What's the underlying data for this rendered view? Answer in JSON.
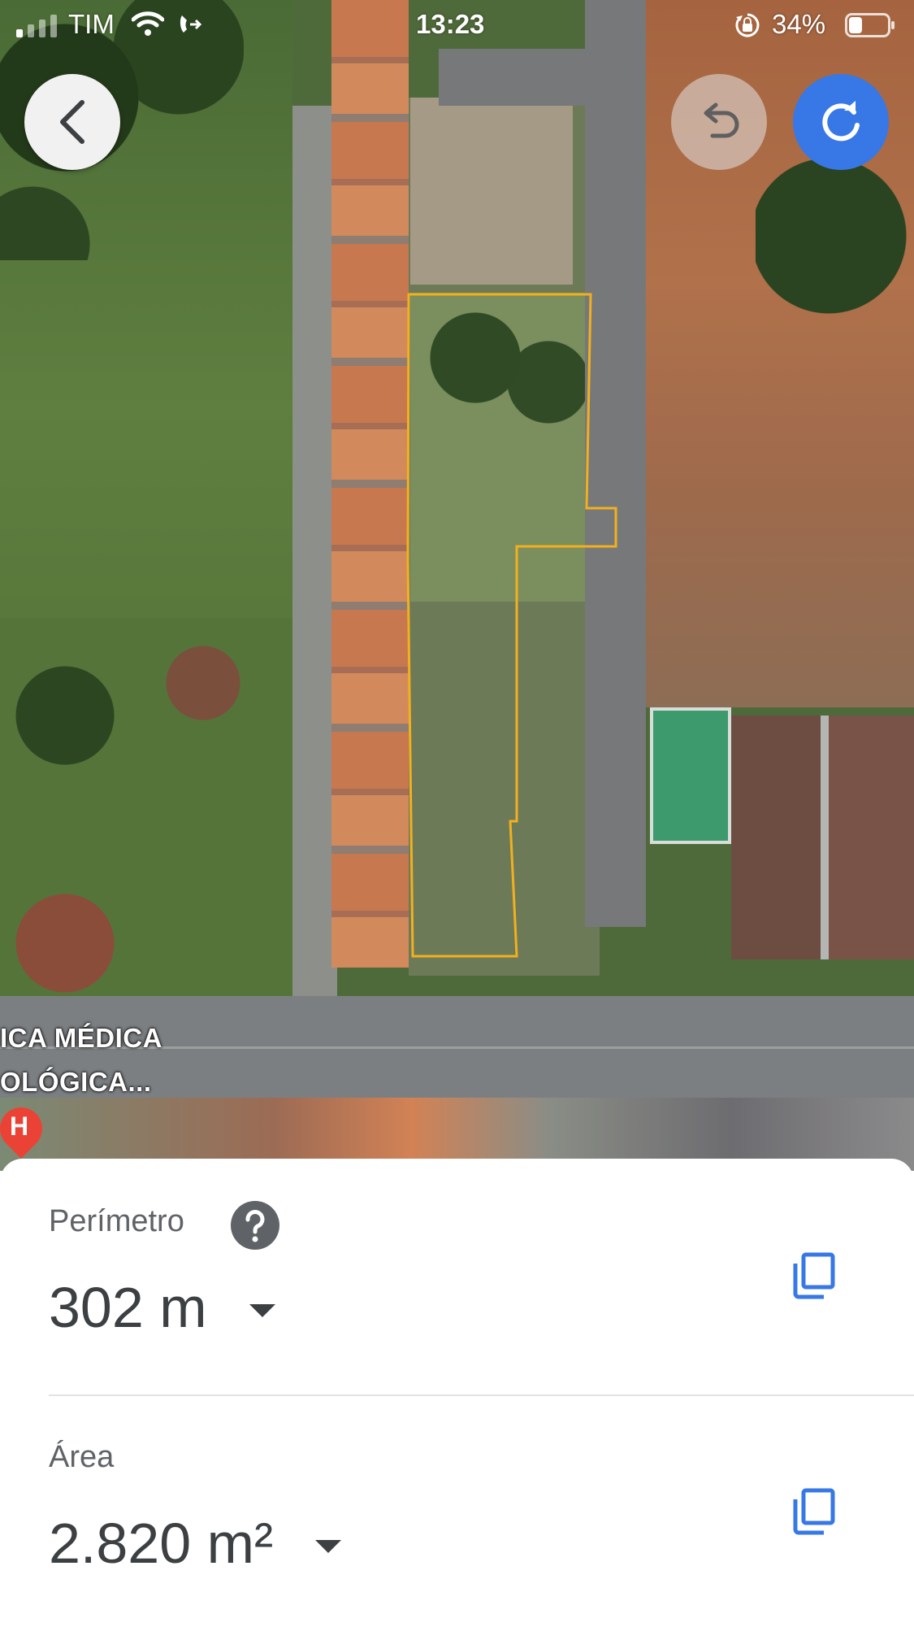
{
  "status_bar": {
    "carrier": "TIM",
    "time": "13:23",
    "battery_percent": "34%",
    "battery_level": 0.34,
    "icons": [
      "signal-icon",
      "wifi-icon",
      "call-forwarding-icon",
      "rotation-lock-icon",
      "battery-icon"
    ]
  },
  "map": {
    "labels": [
      "ICA MÉDICA",
      "OLÓGICA..."
    ],
    "place_pin_letter": "H",
    "outline_color": "#f2b01e",
    "buttons": {
      "back": "back-icon",
      "undo": "undo-icon",
      "redo": "redo-icon"
    },
    "accent_color": "#3778e6"
  },
  "measurements": {
    "perimeter": {
      "label": "Perímetro",
      "value": "302 m",
      "help_icon": "help-icon",
      "copy_icon": "copy-icon"
    },
    "area": {
      "label": "Área",
      "value": "2.820 m²",
      "copy_icon": "copy-icon"
    }
  }
}
